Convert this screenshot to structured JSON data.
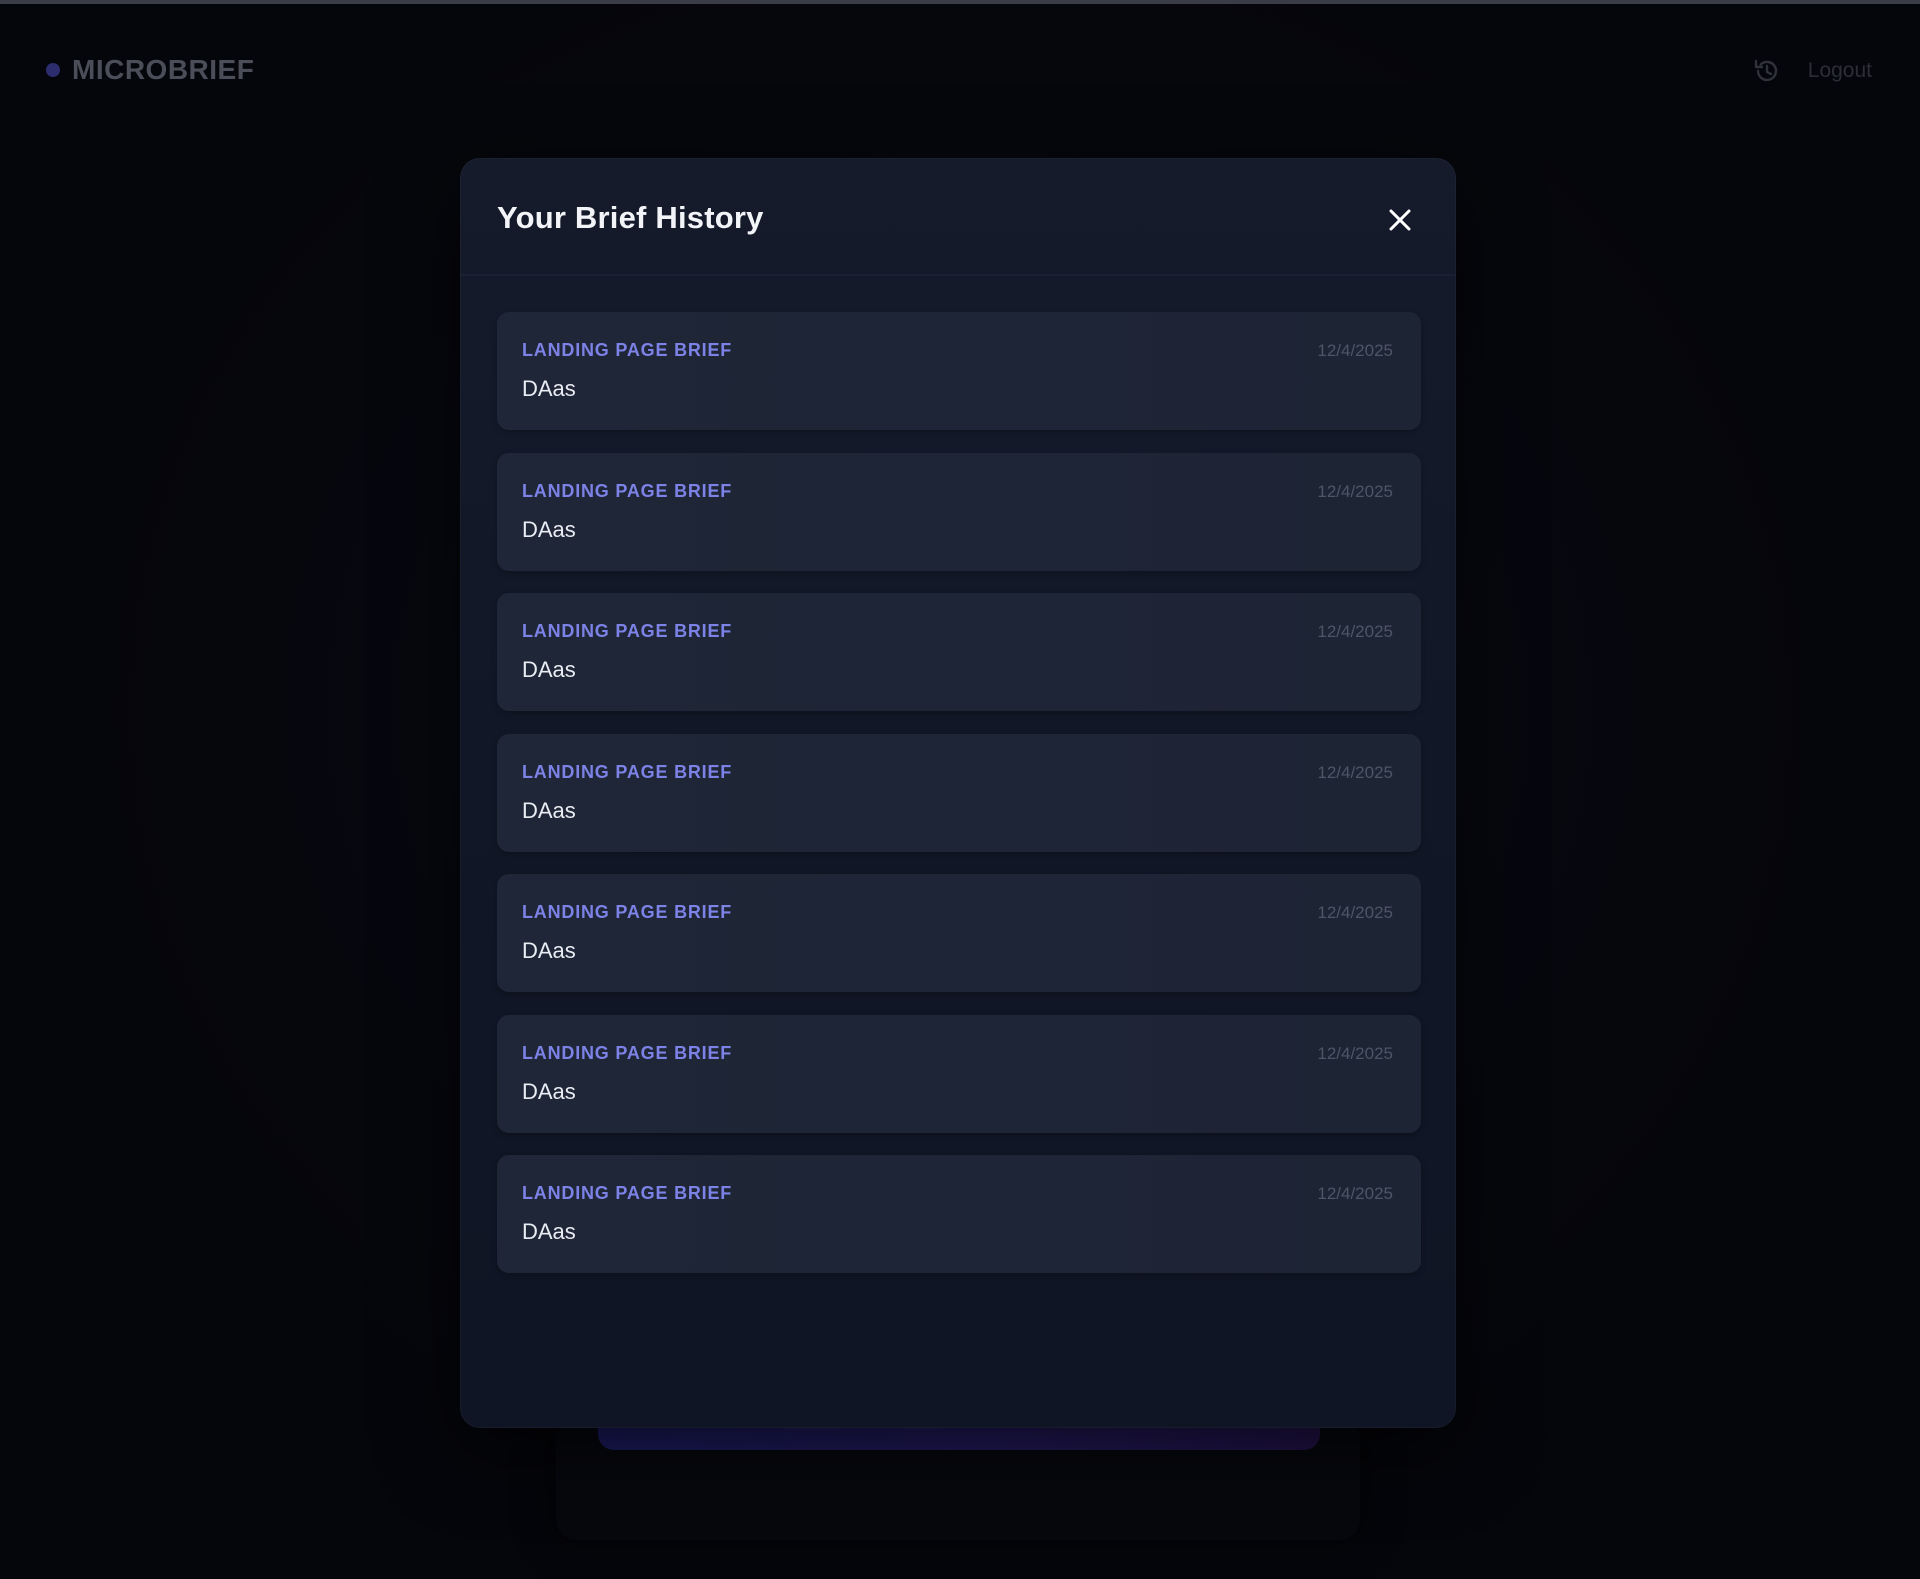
{
  "app": {
    "brand": "MICROBRIEF",
    "logout_label": "Logout"
  },
  "modal": {
    "title": "Your Brief History",
    "items": [
      {
        "type": "LANDING PAGE BRIEF",
        "date": "12/4/2025",
        "title": "DAas"
      },
      {
        "type": "LANDING PAGE BRIEF",
        "date": "12/4/2025",
        "title": "DAas"
      },
      {
        "type": "LANDING PAGE BRIEF",
        "date": "12/4/2025",
        "title": "DAas"
      },
      {
        "type": "LANDING PAGE BRIEF",
        "date": "12/4/2025",
        "title": "DAas"
      },
      {
        "type": "LANDING PAGE BRIEF",
        "date": "12/4/2025",
        "title": "DAas"
      },
      {
        "type": "LANDING PAGE BRIEF",
        "date": "12/4/2025",
        "title": "DAas"
      },
      {
        "type": "LANDING PAGE BRIEF",
        "date": "12/4/2025",
        "title": "DAas"
      }
    ]
  },
  "icons": {
    "history": "history-icon",
    "close": "close-icon",
    "brand_dot": "brand-dot-icon"
  },
  "colors": {
    "accent": "#7c82e6",
    "modal_bg": "#131a2a",
    "card_bg": "#1f2637",
    "page_bg": "#05060b"
  }
}
